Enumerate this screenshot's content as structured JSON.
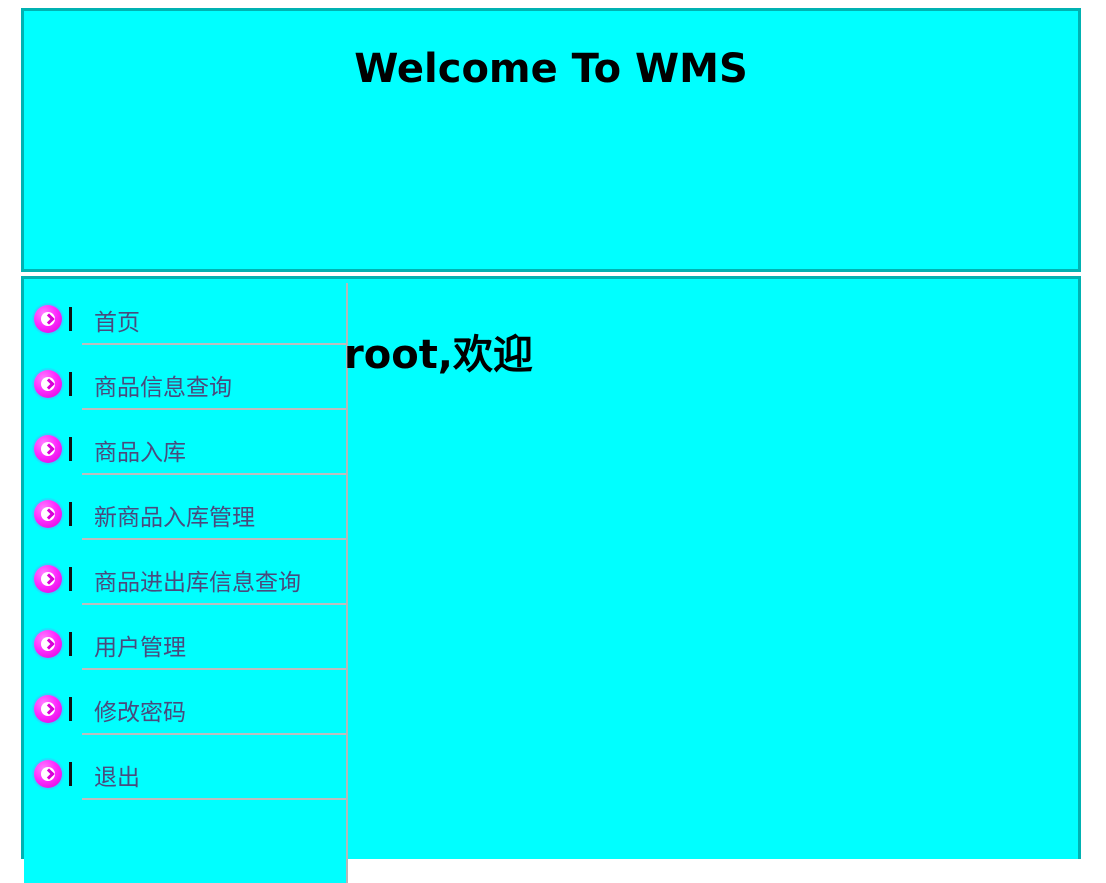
{
  "header": {
    "title": "Welcome To WMS"
  },
  "sidebar": {
    "items": [
      {
        "label": "首页",
        "icon": "arrow-circle-icon"
      },
      {
        "label": "商品信息查询",
        "icon": "arrow-circle-icon"
      },
      {
        "label": "商品入库",
        "icon": "arrow-circle-icon"
      },
      {
        "label": "新商品入库管理",
        "icon": "arrow-circle-icon"
      },
      {
        "label": "商品进出库信息查询",
        "icon": "arrow-circle-icon"
      },
      {
        "label": "用户管理",
        "icon": "arrow-circle-icon"
      },
      {
        "label": "修改密码",
        "icon": "arrow-circle-icon"
      },
      {
        "label": "退出",
        "icon": "arrow-circle-icon"
      }
    ]
  },
  "main": {
    "welcome_text": "root,欢迎"
  },
  "colors": {
    "background": "#00ffff",
    "border": "#00b2b2",
    "link_text": "#4a4a7d",
    "icon_accent": "#ff2cff"
  }
}
